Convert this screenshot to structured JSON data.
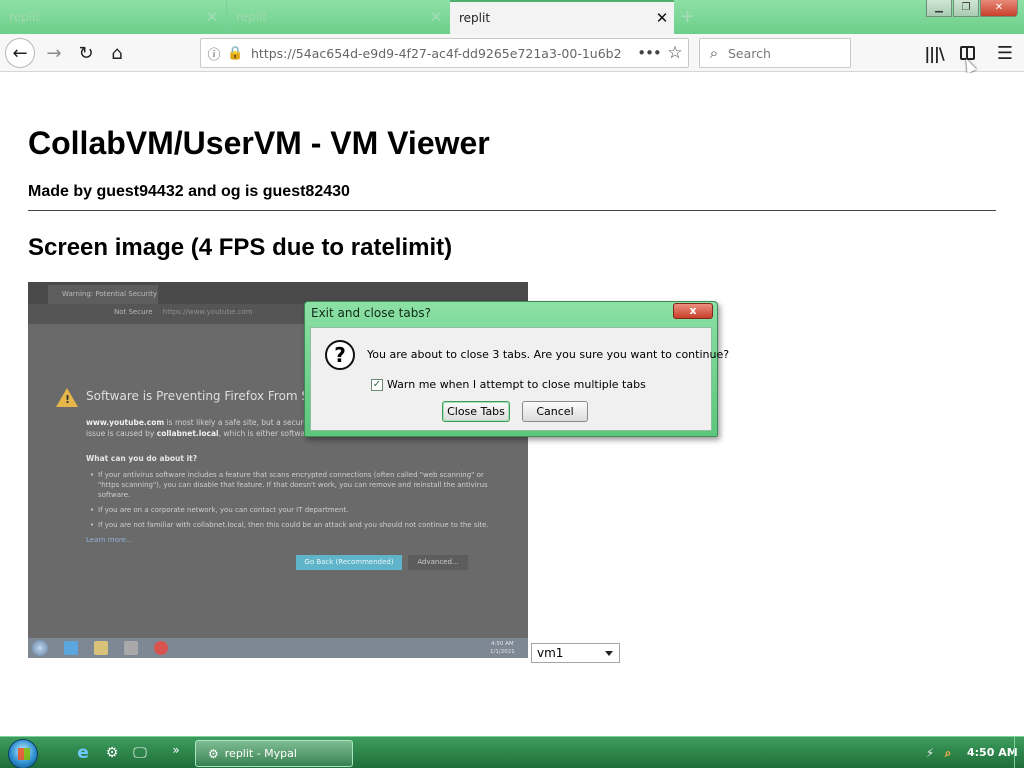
{
  "browser": {
    "tabs": [
      {
        "label": "replit",
        "active": false
      },
      {
        "label": "replit",
        "active": false
      },
      {
        "label": "replit",
        "active": true
      }
    ],
    "new_tab_glyph": "+",
    "url": "https://54ac654d-e9d9-4f27-ac4f-dd9265e721a3-00-1u6b2",
    "search_placeholder": "Search",
    "icons": {
      "back": "arrow-left-icon",
      "forward": "arrow-right-icon",
      "reload": "reload-icon",
      "home": "home-icon",
      "info": "info-icon",
      "lock": "lock-icon",
      "page_actions": "more-dots-icon",
      "bookmark": "star-icon",
      "search": "search-icon",
      "library": "library-icon",
      "sidebar": "sidebar-icon",
      "menu": "hamburger-menu-icon"
    },
    "accent_color": "#6ccf8a"
  },
  "page": {
    "title": "CollabVM/UserVM - VM Viewer",
    "subtitle": "Made by guest94432 and og is guest82430",
    "section_title": "Screen image (4 FPS due to ratelimit)"
  },
  "vm_screen": {
    "tab_label": "Warning: Potential Security Ri...",
    "not_secure": "Not Secure",
    "url_host": "https://www.youtube.com",
    "heading": "Software is Preventing Firefox From Safel",
    "para_host": "www.youtube.com",
    "para_text_1": " is most likely a safe site, but a secure c",
    "para_text_2": "issue is caused by ",
    "para_host_2": "collabnet.local",
    "para_text_3": ", which is either software",
    "subhead": "What can you do about it?",
    "bullets": [
      "If your antivirus software includes a feature that scans encrypted connections (often called \"web scanning\" or \"https scanning\"), you can disable that feature. If that doesn't work, you can remove and reinstall the antivirus software.",
      "If you are on a corporate network, you can contact your IT department.",
      "If you are not familiar with collabnet.local, then this could be an attack and you should not continue to the site."
    ],
    "learn_more": "Learn more...",
    "go_back_button": "Go Back (Recommended)",
    "advanced_button": "Advanced...",
    "clock_time": "4:50 AM",
    "clock_date": "1/1/2021"
  },
  "dialog": {
    "title": "Exit and close tabs?",
    "close_glyph": "x",
    "icon": "question-icon",
    "message": "You are about to close 3 tabs. Are you sure you want to continue?",
    "warn_checkbox_label": "Warn me when I attempt to close multiple tabs",
    "warn_checked": true,
    "close_tabs_button": "Close Tabs",
    "cancel_button": "Cancel"
  },
  "vm_select": {
    "selected": "vm1"
  },
  "taskbar": {
    "active_window_label": "replit - Mypal",
    "more_glyph": "»",
    "clock": "4:50 AM",
    "icons": {
      "start": "windows-start-icon",
      "ie": "internet-explorer-icon",
      "gear": "settings-icon",
      "monitor": "monitor-icon",
      "network": "network-icon",
      "search": "search-icon"
    }
  }
}
